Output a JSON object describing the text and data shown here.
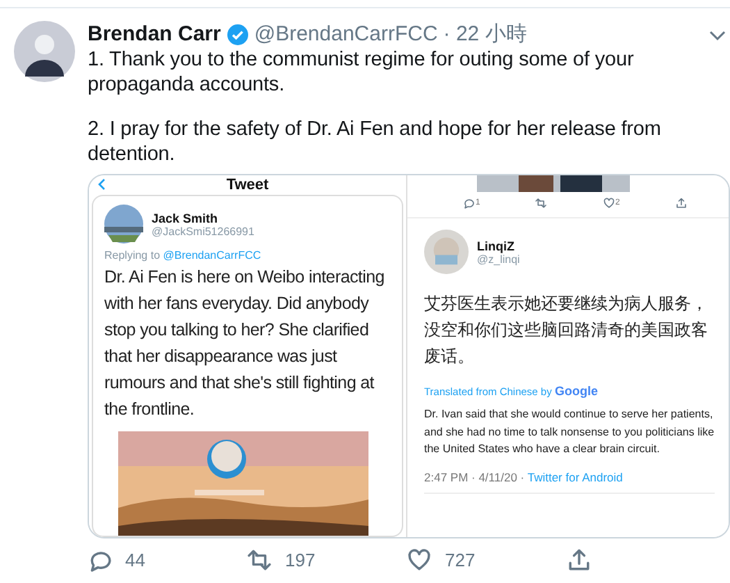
{
  "tweet": {
    "author": {
      "name": "Brendan Carr",
      "verified": true,
      "handle": "@BrendanCarrFCC",
      "time": "· 22 小時"
    },
    "paragraphs": [
      "1. Thank you to the communist regime for outing some of your propaganda accounts.",
      "2. I pray for the safety of Dr. Ai Fen and hope for her release from detention."
    ],
    "media": {
      "left": {
        "header_title": "Tweet",
        "author": {
          "name": "Jack Smith",
          "handle": "@JackSmi51266991"
        },
        "replying_prefix": "Replying to",
        "replying_to": "@BrendanCarrFCC",
        "text": "Dr. Ai Fen is here on Weibo interacting with her fans everyday. Did anybody stop you talking to her? She clarified that her disappearance was just rumours and that she's still fighting at the frontline."
      },
      "right": {
        "top_actions": [
          {
            "kind": "reply",
            "count": "1"
          },
          {
            "kind": "retweet"
          },
          {
            "kind": "like",
            "count": "2"
          },
          {
            "kind": "share"
          }
        ],
        "author": {
          "name": "LinqiZ",
          "handle": "@z_linqi"
        },
        "text": "艾芬医生表示她还要继续为病人服务，没空和你们这些脑回路清奇的美国政客废话。",
        "translation_label": "Translated from Chinese by",
        "translation_brand": "Google",
        "translation": "Dr. Ivan said that she would continue to serve her patients, and she had no time to talk nonsense to you politicians like the United States who have a clear brain circuit.",
        "meta": "2:47 PM · 4/11/20 ·",
        "source": "Twitter for Android"
      }
    },
    "actions": [
      {
        "kind": "reply",
        "count": "44"
      },
      {
        "kind": "retweet",
        "count": "197"
      },
      {
        "kind": "like",
        "count": "727"
      },
      {
        "kind": "share"
      }
    ]
  }
}
